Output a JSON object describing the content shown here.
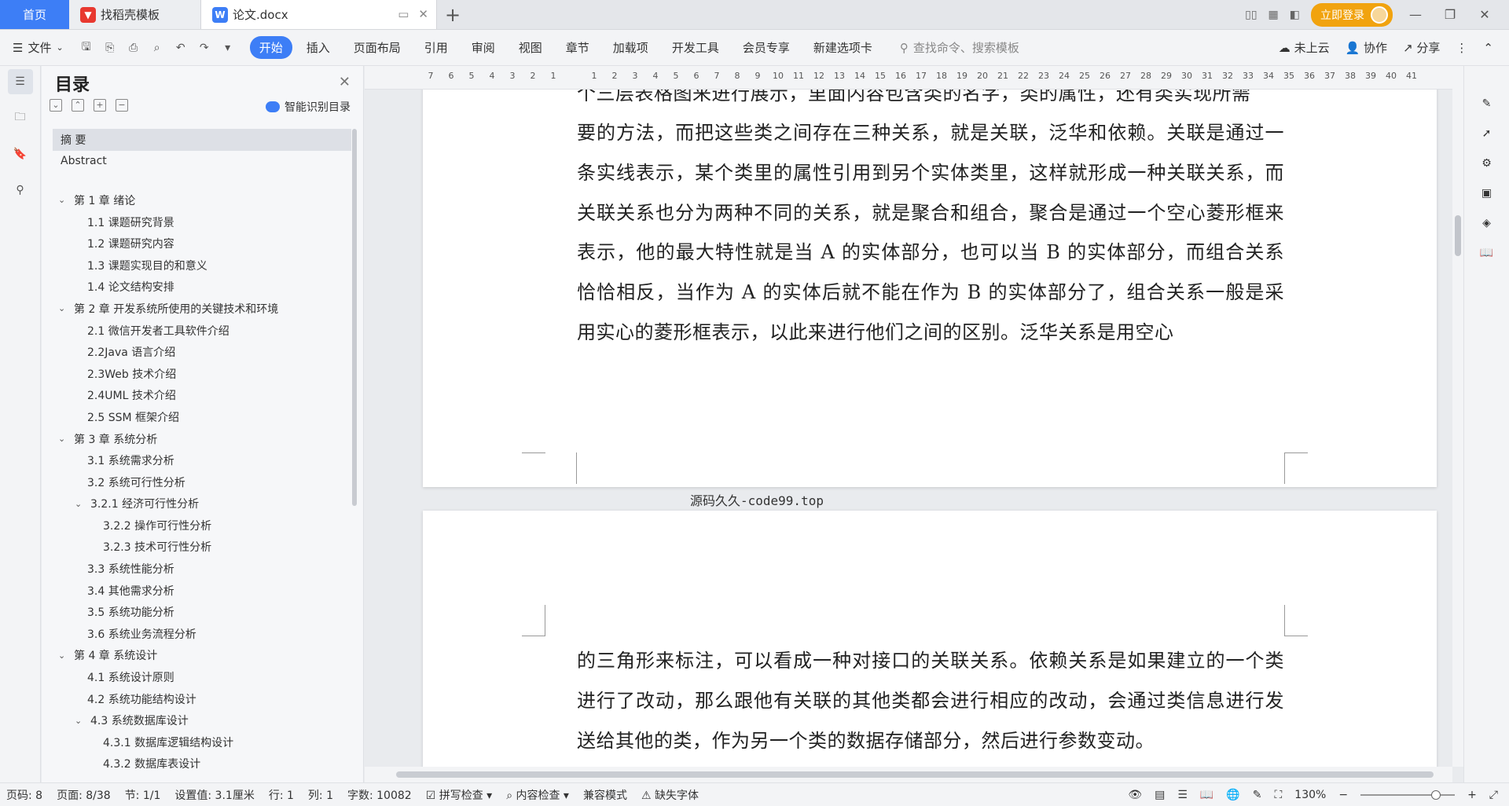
{
  "tabs": {
    "home": "首页",
    "template": "找稻壳模板",
    "document": "论文.docx"
  },
  "title_bar": {
    "login": "立即登录"
  },
  "menubar": {
    "file": "文件",
    "items": [
      "开始",
      "插入",
      "页面布局",
      "引用",
      "审阅",
      "视图",
      "章节",
      "加载项",
      "开发工具",
      "会员专享",
      "新建选项卡"
    ],
    "search_placeholder": "查找命令、搜索模板",
    "cloud": "未上云",
    "collab": "协作",
    "share": "分享"
  },
  "toc": {
    "title": "目录",
    "ai_label": "智能识别目录",
    "entries": [
      {
        "text": "摘  要",
        "level": 0
      },
      {
        "text": "Abstract",
        "level": 0
      },
      {
        "text": "第 1 章  绪论",
        "level": 1
      },
      {
        "text": "1.1 课题研究背景",
        "level": 2
      },
      {
        "text": "1.2 课题研究内容",
        "level": 2
      },
      {
        "text": "1.3 课题实现目的和意义",
        "level": 2
      },
      {
        "text": "1.4 论文结构安排",
        "level": 2
      },
      {
        "text": "第 2 章  开发系统所使用的关键技术和环境",
        "level": 1
      },
      {
        "text": "2.1 微信开发者工具软件介绍",
        "level": 2
      },
      {
        "text": "2.2Java 语言介绍",
        "level": 2
      },
      {
        "text": "2.3Web 技术介绍",
        "level": 2
      },
      {
        "text": "2.4UML 技术介绍",
        "level": 2
      },
      {
        "text": "2.5 SSM 框架介绍",
        "level": 2
      },
      {
        "text": "第 3 章  系统分析",
        "level": 1
      },
      {
        "text": "3.1 系统需求分析",
        "level": 2
      },
      {
        "text": "3.2 系统可行性分析",
        "level": 2
      },
      {
        "text": "3.2.1 经济可行性分析",
        "level": 2
      },
      {
        "text": "3.2.2 操作可行性分析",
        "level": 3
      },
      {
        "text": "3.2.3 技术可行性分析",
        "level": 3
      },
      {
        "text": "3.3 系统性能分析",
        "level": 2
      },
      {
        "text": "3.4 其他需求分析",
        "level": 2
      },
      {
        "text": "3.5 系统功能分析",
        "level": 2
      },
      {
        "text": "3.6 系统业务流程分析",
        "level": 2
      },
      {
        "text": "第 4 章  系统设计",
        "level": 1
      },
      {
        "text": "4.1 系统设计原则",
        "level": 2
      },
      {
        "text": "4.2 系统功能结构设计",
        "level": 2
      },
      {
        "text": "4.3 系统数据库设计",
        "level": 2
      },
      {
        "text": "4.3.1 数据库逻辑结构设计",
        "level": 3
      },
      {
        "text": "4.3.2 数据库表设计",
        "level": 3
      }
    ]
  },
  "ruler": {
    "numbers": [
      "7",
      "6",
      "5",
      "4",
      "3",
      "2",
      "1",
      "1",
      "2",
      "3",
      "4",
      "5",
      "6",
      "7",
      "8",
      "9",
      "10",
      "11",
      "12",
      "13",
      "14",
      "15",
      "16",
      "17",
      "18",
      "19",
      "20",
      "21",
      "22",
      "23",
      "24",
      "25",
      "26",
      "27",
      "28",
      "29",
      "30",
      "31",
      "32",
      "33",
      "34",
      "35",
      "36",
      "37",
      "38",
      "39",
      "40",
      "41"
    ]
  },
  "document": {
    "page1_partial_line": "个三层表格图来进行展示，里面内容包含类的名字，类的属性，还有类实现所需",
    "page1_text": "要的方法，而把这些类之间存在三种关系，就是关联，泛华和依赖。关联是通过一条实线表示，某个类里的属性引用到另个实体类里，这样就形成一种关联关系，而关联关系也分为两种不同的关系，就是聚合和组合，聚合是通过一个空心菱形框来表示，他的最大特性就是当 A 的实体部分，也可以当 B 的实体部分，而组合关系恰恰相反，当作为 A 的实体后就不能在作为 B 的实体部分了，组合关系一般是采用实心的菱形框表示，以此来进行他们之间的区别。泛华关系是用空心",
    "footer": "源码久久-code99.top",
    "page2_text": "的三角形来标注，可以看成一种对接口的关联关系。依赖关系是如果建立的一个类进行了改动，那么跟他有关联的其他类都会进行相应的改动，会通过类信息进行发送给其他的类，作为另一个类的数据存储部分，然后进行参数变动。"
  },
  "statusbar": {
    "page_no": "页码: 8",
    "page": "页面: 8/38",
    "section": "节: 1/1",
    "setting": "设置值: 3.1厘米",
    "row": "行: 1",
    "col": "列: 1",
    "words": "字数: 10082",
    "spell": "拼写检查",
    "content_check": "内容检查",
    "compat": "兼容模式",
    "missing_font": "缺失字体",
    "zoom": "130%"
  },
  "colors": {
    "accent": "#3d7ef6",
    "login": "#f1a30f"
  }
}
